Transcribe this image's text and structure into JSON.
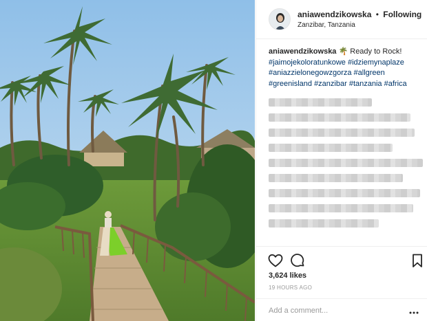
{
  "post": {
    "username": "aniawendzikowska",
    "follow_separator": "•",
    "follow_state": "Following",
    "location": "Zanzibar, Tanzania",
    "caption": {
      "username": "aniawendzikowska",
      "text": " 🌴 Ready to Rock! ",
      "hashtags": [
        "#jaimojekoloratunkowe",
        "#idziemynaplaze",
        "#aniazzielonegowzgorza",
        "#allgreen",
        "#greenisland",
        "#zanzibar",
        "#tanzania",
        "#africa"
      ]
    },
    "likes": "3,624 likes",
    "time_ago": "19 HOURS AGO",
    "comment_placeholder": "Add a comment..."
  },
  "icons": {
    "like": "heart-icon",
    "comment": "comment-bubble-icon",
    "save": "bookmark-icon",
    "more": "more-options-icon"
  },
  "colors": {
    "hashtag": "#003569",
    "text": "#262626",
    "muted": "#999999",
    "divider": "#efefef"
  }
}
